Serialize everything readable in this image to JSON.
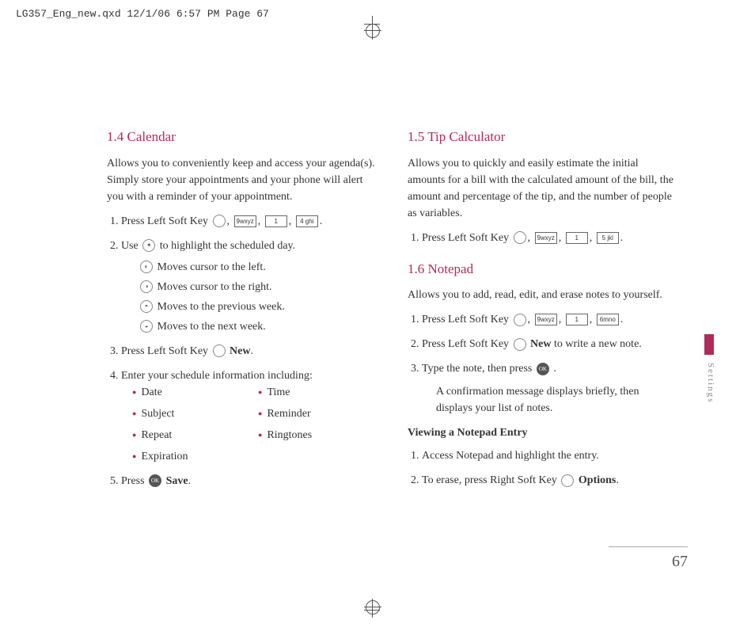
{
  "header": "LG357_Eng_new.qxd  12/1/06  6:57 PM  Page 67",
  "pagenum": "67",
  "side_label": "Settings",
  "left": {
    "h_calendar": "1.4 Calendar",
    "calendar_intro": "Allows you to conveniently keep and access your agenda(s). Simply store your appointments and your phone will alert you with a reminder of your appointment.",
    "step1_a": "Press Left Soft Key ",
    "comma": ", ",
    "period": ".",
    "key_9": "9wxyz",
    "key_1": "1",
    "key_4": "4 ghi",
    "step2_a": "Use ",
    "step2_b": " to highlight the scheduled day.",
    "nav_left": "Moves cursor to the left.",
    "nav_right": "Moves cursor to the right.",
    "nav_up": "Moves to the previous week.",
    "nav_down": "Moves to the next week.",
    "step3_a": "Press Left Soft Key ",
    "step3_b": "New",
    "step4": "Enter your schedule information including:",
    "bullets": {
      "date": "Date",
      "time": "Time",
      "subject": "Subject",
      "reminder": "Reminder",
      "repeat": "Repeat",
      "ringtones": "Ringtones",
      "expiration": "Expiration"
    },
    "step5_a": "Press ",
    "step5_b": "Save",
    "ok": "OK"
  },
  "right": {
    "h_tip": "1.5 Tip Calculator",
    "tip_intro": "Allows you to quickly and easily estimate the initial amounts for a bill with the calculated amount of the bill, the amount and percentage of the tip, and the number of people as variables.",
    "tip_step1": "Press Left Soft Key ",
    "key_9": "9wxyz",
    "key_1": "1",
    "key_5": "5 jkl",
    "h_notepad": "1.6 Notepad",
    "notepad_intro": "Allows you to add, read, edit, and erase notes to yourself.",
    "np_step1": "Press Left Soft Key ",
    "key_6": "6mno",
    "np_step2_a": "Press Left Soft Key ",
    "np_step2_b": "New",
    "np_step2_c": " to write a new note.",
    "np_step3_a": "Type the note, then press ",
    "np_step3_b": ".",
    "np_confirm": "A confirmation message displays briefly, then displays your list of notes.",
    "view_head": "Viewing a Notepad Entry",
    "view_step1": "Access Notepad and highlight the entry.",
    "view_step2_a": "To erase, press Right Soft Key ",
    "view_step2_b": "Options",
    "ok": "OK"
  }
}
